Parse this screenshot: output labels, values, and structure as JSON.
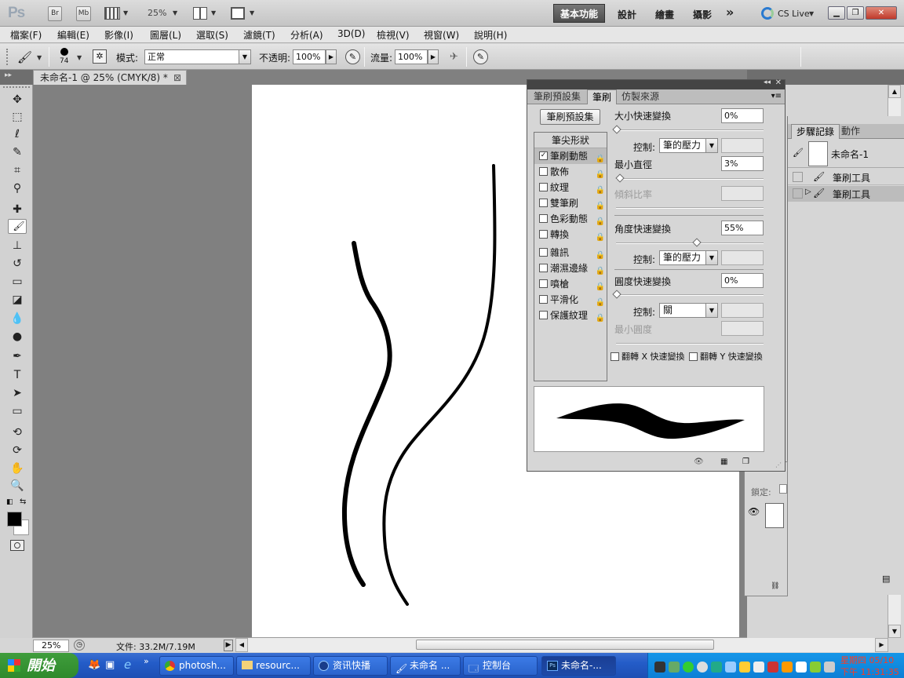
{
  "app": {
    "logo": "Ps",
    "br": "Br",
    "mb": "Mb",
    "zoom": "25%",
    "workspaces": {
      "active": "基本功能",
      "design": "設計",
      "paint": "繪畫",
      "photo": "攝影",
      "more": "»"
    },
    "cslive": "CS Live"
  },
  "menu": [
    "檔案(F)",
    "編輯(E)",
    "影像(I)",
    "圖層(L)",
    "選取(S)",
    "濾鏡(T)",
    "分析(A)",
    "3D(D)",
    "檢視(V)",
    "視窗(W)",
    "說明(H)"
  ],
  "options": {
    "brush_size": "74",
    "mode_label": "模式:",
    "mode_value": "正常",
    "opacity_label": "不透明:",
    "opacity_value": "100%",
    "flow_label": "流量:",
    "flow_value": "100%"
  },
  "document": {
    "tab_title": "未命名-1 @ 25% (CMYK/8) *",
    "close": "⊠"
  },
  "status": {
    "zoom": "25%",
    "doc_info": "文件: 33.2M/7.19M"
  },
  "brush_panel": {
    "tabs": [
      "筆刷預設集",
      "筆刷",
      "仿製來源"
    ],
    "preset_button": "筆刷預設集",
    "tip_shape": "筆尖形狀",
    "options": [
      {
        "label": "筆刷動態",
        "checked": true
      },
      {
        "label": "散佈",
        "checked": false
      },
      {
        "label": "紋理",
        "checked": false
      },
      {
        "label": "雙筆刷",
        "checked": false
      },
      {
        "label": "色彩動態",
        "checked": false
      },
      {
        "label": "轉換",
        "checked": false
      },
      {
        "label": "雜訊",
        "checked": false
      },
      {
        "label": "潮濕邊緣",
        "checked": false
      },
      {
        "label": "噴槍",
        "checked": false
      },
      {
        "label": "平滑化",
        "checked": false
      },
      {
        "label": "保護紋理",
        "checked": false
      }
    ],
    "size_jitter_label": "大小快速變換",
    "size_jitter_value": "0%",
    "control_label": "控制:",
    "control_pen_pressure": "筆的壓力",
    "min_diameter_label": "最小直徑",
    "min_diameter_value": "3%",
    "tilt_scale_label": "傾斜比率",
    "angle_jitter_label": "角度快速變換",
    "angle_jitter_value": "55%",
    "roundness_jitter_label": "圓度快速變換",
    "roundness_jitter_value": "0%",
    "control_off": "關",
    "min_roundness_label": "最小圓度",
    "flip_x": "翻轉 X 快速變換",
    "flip_y": "翻轉 Y 快速變換"
  },
  "history_panel": {
    "tabs": [
      "步驟記錄",
      "動作"
    ],
    "snapshot": "未命名-1",
    "items": [
      "筆刷工具",
      "筆刷工具"
    ]
  },
  "layers_panel": {
    "lock_label": "鎖定:"
  },
  "taskbar": {
    "start": "開始",
    "tasks": [
      "photosh...",
      "resourc...",
      "资讯快播",
      "未命名 ...",
      "控制台",
      "未命名-..."
    ],
    "clock_day": "星期四 05/10",
    "clock_time": "下午 11:31:35"
  },
  "colors": {
    "accent": "#245cc8",
    "tray": "#1596e8",
    "clock": "#ff3b1f"
  }
}
